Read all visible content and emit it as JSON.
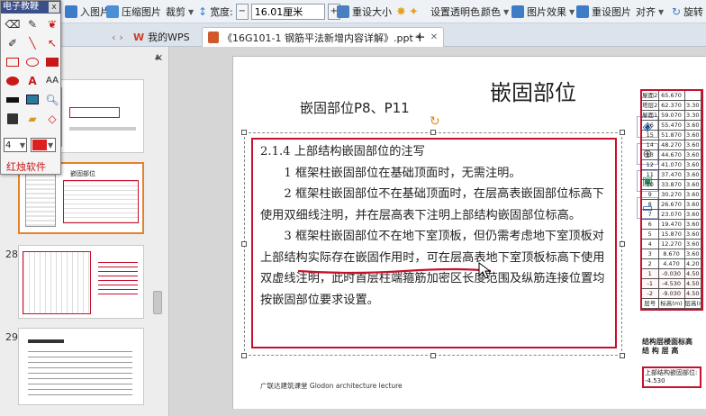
{
  "ribbon": {
    "items": [
      {
        "name": "insert-picture",
        "label": "入图片",
        "color": "#3d7cc7"
      },
      {
        "name": "compress-picture",
        "label": "压缩图片",
        "color": "#4c8fd6"
      },
      {
        "name": "crop",
        "label": "裁剪",
        "color": "#555555"
      },
      {
        "name": "width",
        "label": "宽度:"
      },
      {
        "name": "reset-size",
        "label": "重设大小",
        "color": "#4a7fc0"
      },
      {
        "name": "set-transparent",
        "label": "设置透明色",
        "color": "#e7a11d"
      },
      {
        "name": "color",
        "label": "颜色",
        "color": "#c43030"
      },
      {
        "name": "picture-effect",
        "label": "图片效果",
        "color": "#3d7cc7"
      },
      {
        "name": "reset-picture",
        "label": "重设图片",
        "color": "#3d7cc7"
      },
      {
        "name": "align",
        "label": "对齐"
      },
      {
        "name": "rotate",
        "label": "旋转"
      }
    ],
    "width_value": "16.01厘米"
  },
  "tabs": [
    {
      "name": "tab-wps",
      "label": "我的WPS",
      "icon_color": "#d03a2a"
    },
    {
      "name": "tab-ppt",
      "label": "《16G101-1 钢筋平法新增内容详解》.ppt *",
      "icon_color": "#d0582a"
    }
  ],
  "tab_new": "+",
  "toolbox": {
    "title": "电子教鞭",
    "close": "x",
    "label": "红烛软件",
    "line_width": "4",
    "pen_color": "#e02020"
  },
  "thumbnails": [
    {
      "num": "",
      "selected": false
    },
    {
      "num": "",
      "selected": true
    },
    {
      "num": "28",
      "selected": false
    },
    {
      "num": "29",
      "selected": false
    }
  ],
  "slide": {
    "title": "嵌固部位",
    "subtitle": "嵌固部位P8、P11",
    "box_heading": "2.1.4 上部结构嵌固部位的注写",
    "paragraphs": [
      "1 框架柱嵌固部位在基础顶面时，无需注明。",
      "2 框架柱嵌固部位不在基础顶面时，在层高表嵌固部位标高下使用双细线注明，并在层高表下注明上部结构嵌固部位标高。",
      "3 框架柱嵌固部位不在地下室顶板，但仍需考虑地下室顶板对上部结构实际存在嵌固作用时，可在层高表地下室顶板标高下使用双虚线注明，此时首层柱端箍筋加密区长度范围及纵筋连接位置均按嵌固部位要求设置。"
    ],
    "footer": "广联达建筑课堂   Glodon architecture lecture",
    "table_rows": [
      [
        "屋面2",
        "65.670",
        ""
      ],
      [
        "塔层2",
        "62.370",
        "3.30"
      ],
      [
        "屋面1\n(塔层1)",
        "59.070",
        "3.30"
      ],
      [
        "16",
        "55.470",
        "3.60"
      ],
      [
        "15",
        "51.870",
        "3.60"
      ],
      [
        "14",
        "48.270",
        "3.60"
      ],
      [
        "13",
        "44.670",
        "3.60"
      ],
      [
        "12",
        "41.070",
        "3.60"
      ],
      [
        "11",
        "37.470",
        "3.60"
      ],
      [
        "10",
        "33.870",
        "3.60"
      ],
      [
        "9",
        "30.270",
        "3.60"
      ],
      [
        "8",
        "26.670",
        "3.60"
      ],
      [
        "7",
        "23.070",
        "3.60"
      ],
      [
        "6",
        "19.470",
        "3.60"
      ],
      [
        "5",
        "15.870",
        "3.60"
      ],
      [
        "4",
        "12.270",
        "3.60"
      ],
      [
        "3",
        "8.670",
        "3.60"
      ],
      [
        "2",
        "4.470",
        "4.20"
      ],
      [
        "1",
        "-0.030",
        "4.50"
      ],
      [
        "-1",
        "-4.530",
        "4.50"
      ],
      [
        "-2",
        "-9.030",
        "4.50"
      ],
      [
        "层号",
        "标高(m)",
        "层高(m)"
      ]
    ],
    "table_caption": "结构层楼面标高\n结 构 层 高",
    "table_note": "上部结构嵌固部位:\n-4.530"
  },
  "colors": {
    "box_red": "#c8102e",
    "underline_red": "#c8102e",
    "rotate_handle": "#e88a16"
  }
}
